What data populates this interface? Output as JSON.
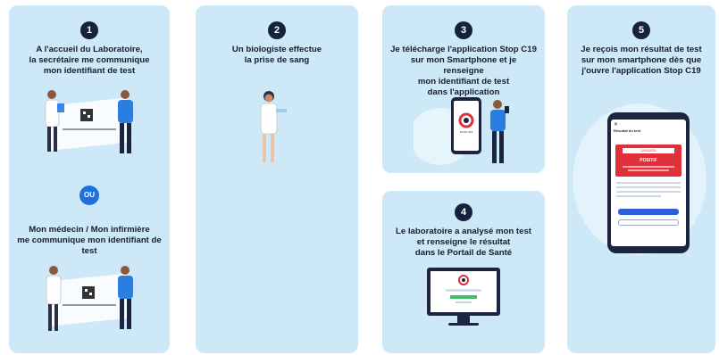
{
  "steps": [
    {
      "number": "1",
      "text_a": "A l'accueil du Laboratoire,",
      "text_b": "la secrétaire me communique",
      "text_c": "mon identifiant de test"
    },
    {
      "number": "2",
      "text_a": "Un biologiste effectue",
      "text_b": "la prise de sang"
    },
    {
      "number": "3",
      "text_a": "Je télécharge l'application Stop C19",
      "text_b": "sur mon Smartphone et je renseigne",
      "text_c": "mon identifiant de test",
      "text_d": "dans l'application"
    },
    {
      "number": "4",
      "text_a": "Le laboratoire a analysé mon test",
      "text_b": "et renseigne le résultat",
      "text_c": "dans le Portail de Santé"
    },
    {
      "number": "5",
      "text_a": "Je reçois mon résultat de test",
      "text_b": "sur mon smartphone dès que",
      "text_c": "j'ouvre l'application Stop C19"
    }
  ],
  "alt": {
    "badge": "OU",
    "text_a": "Mon médecin / Mon infirmière",
    "text_b": "me communique mon identifiant de",
    "text_c": "test"
  },
  "app": {
    "name": "STOP C19",
    "result_header": "Résultat du test",
    "result_date": "12/04/2021",
    "result_value": "POSITIF"
  },
  "colors": {
    "card_bg": "#cde8f7",
    "step_circle": "#16213f",
    "ou_badge": "#1f6fe0",
    "person_shirt": "#2b7de0",
    "person_pants": "#1b2440",
    "result_red": "#e0303b"
  }
}
